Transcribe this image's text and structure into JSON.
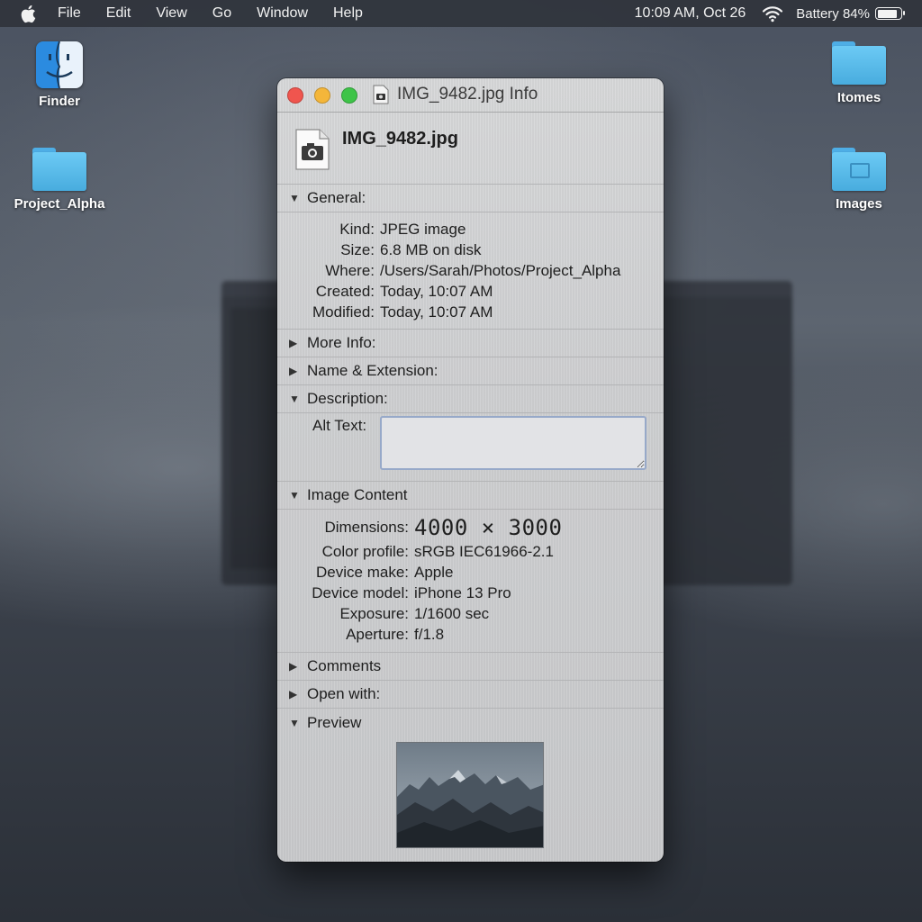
{
  "menubar": {
    "items": [
      "File",
      "Edit",
      "View",
      "Go",
      "Window",
      "Help"
    ],
    "clock": "10:09 AM, Oct 26",
    "battery_label": "Battery 84%",
    "battery_level": 0.84
  },
  "desktop": {
    "icons": [
      {
        "label": "Finder",
        "icon": "finder-icon"
      },
      {
        "label": "Project_Alpha",
        "icon": "folder-icon"
      },
      {
        "label": "Itomes",
        "icon": "folder-icon"
      },
      {
        "label": "Images",
        "icon": "images-folder-icon"
      }
    ]
  },
  "info_window": {
    "title": "IMG_9482.jpg Info",
    "filename": "IMG_9482.jpg",
    "general": {
      "heading": "General:",
      "rows": [
        {
          "key": "Kind:",
          "value": "JPEG image"
        },
        {
          "key": "Size:",
          "value": "6.8 MB on disk"
        },
        {
          "key": "Where:",
          "value": "/Users/Sarah/Photos/Project_Alpha"
        },
        {
          "key": "Created:",
          "value": "Today, 10:07 AM"
        },
        {
          "key": "Modified:",
          "value": "Today, 10:07 AM"
        }
      ]
    },
    "more_info": {
      "heading": "More Info:"
    },
    "name_extension": {
      "heading": "Name & Extension:"
    },
    "description": {
      "heading": "Description:",
      "alt_label": "Alt Text:",
      "alt_value": ""
    },
    "image_content": {
      "heading": "Image Content",
      "dimensions_key": "Dimensions:",
      "dimensions_value": "4000 × 3000",
      "rows": [
        {
          "key": "Color profile:",
          "value": "sRGB IEC61966-2.1"
        },
        {
          "key": "Device make:",
          "value": "Apple"
        },
        {
          "key": "Device model:",
          "value": "iPhone 13 Pro"
        },
        {
          "key": "Exposure:",
          "value": "1/1600 sec"
        },
        {
          "key": "Aperture:",
          "value": "f/1.8"
        }
      ]
    },
    "comments": {
      "heading": "Comments"
    },
    "open_with": {
      "heading": "Open with:"
    },
    "preview": {
      "heading": "Preview"
    }
  },
  "colors": {
    "close": "#f0554e",
    "minimize": "#f4b63a",
    "zoom": "#3ec448",
    "folder": "#5cbcec",
    "input_border": "#97a9c9"
  }
}
